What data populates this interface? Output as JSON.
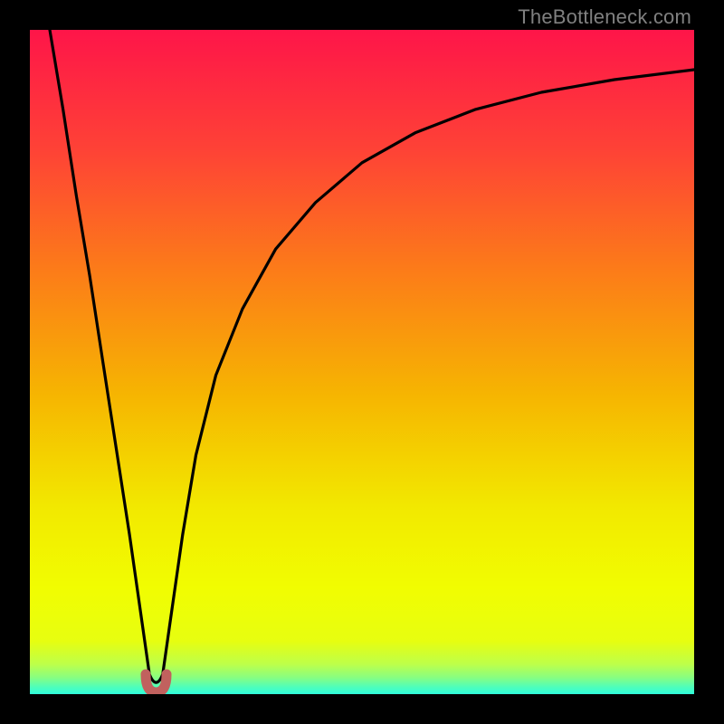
{
  "watermark": {
    "text": "TheBottleneck.com"
  },
  "colors": {
    "border": "#000000",
    "curve": "#000000",
    "marker": "#c1615e",
    "gradient_stops": [
      {
        "offset": 0.0,
        "color": "#fe1549"
      },
      {
        "offset": 0.18,
        "color": "#fe4236"
      },
      {
        "offset": 0.36,
        "color": "#fc7b19"
      },
      {
        "offset": 0.55,
        "color": "#f6b501"
      },
      {
        "offset": 0.72,
        "color": "#f2e900"
      },
      {
        "offset": 0.84,
        "color": "#f1fd01"
      },
      {
        "offset": 0.92,
        "color": "#e7fe10"
      },
      {
        "offset": 0.955,
        "color": "#bdff4a"
      },
      {
        "offset": 0.975,
        "color": "#88fe81"
      },
      {
        "offset": 0.99,
        "color": "#4cfebd"
      },
      {
        "offset": 1.0,
        "color": "#2ffedb"
      }
    ]
  },
  "chart_data": {
    "type": "line",
    "title": "",
    "xlabel": "",
    "ylabel": "",
    "xlim": [
      0,
      100
    ],
    "ylim": [
      0,
      100
    ],
    "series": [
      {
        "name": "bottleneck-curve",
        "x": [
          3,
          5,
          7,
          9,
          11,
          13,
          15,
          17,
          18,
          19,
          20,
          21,
          23,
          25,
          28,
          32,
          37,
          43,
          50,
          58,
          67,
          77,
          88,
          100
        ],
        "y": [
          100,
          88,
          75,
          63,
          50,
          37,
          24,
          10,
          3,
          0.5,
          3,
          10,
          24,
          36,
          48,
          58,
          67,
          74,
          80,
          84.5,
          88,
          90.6,
          92.5,
          94
        ]
      }
    ],
    "marker": {
      "x": 19,
      "y": 0.5,
      "label": "optimal-point"
    }
  }
}
